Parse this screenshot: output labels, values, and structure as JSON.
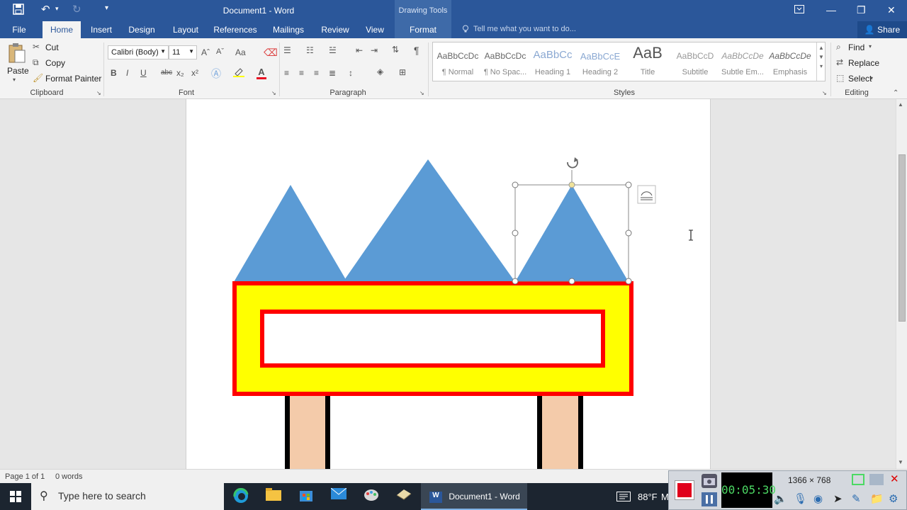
{
  "titlebar": {
    "title": "Document1 - Word",
    "contextual_group": "Drawing Tools",
    "save_icon": "save-icon",
    "undo_icon": "undo-icon",
    "redo_icon": "redo-icon",
    "customize_icon": "customize-qat-icon"
  },
  "tabs": {
    "file": "File",
    "home": "Home",
    "insert": "Insert",
    "design": "Design",
    "layout": "Layout",
    "references": "References",
    "mailings": "Mailings",
    "review": "Review",
    "view": "View",
    "format": "Format",
    "tell_me": "Tell me what you want to do...",
    "share": "Share"
  },
  "clipboard": {
    "paste": "Paste",
    "cut": "Cut",
    "copy": "Copy",
    "format_painter": "Format Painter",
    "label": "Clipboard"
  },
  "font": {
    "family": "Calibri (Body)",
    "size": "11",
    "label": "Font",
    "bold": "B",
    "italic": "I",
    "underline": "U",
    "strike": "abc",
    "subscript": "x₂",
    "superscript": "x²",
    "grow": "Aˆ",
    "shrink": "Aˇ",
    "change_case": "Aa",
    "font_color": "A",
    "font_color_hex": "#e81123",
    "highlight_hex": "#ffff00"
  },
  "paragraph": {
    "label": "Paragraph",
    "pilcrow": "¶"
  },
  "styles": {
    "label": "Styles",
    "items": [
      {
        "sample": "AaBbCcDc",
        "name": "¶ Normal"
      },
      {
        "sample": "AaBbCcDc",
        "name": "¶ No Spac..."
      },
      {
        "sample": "AaBbCc",
        "name": "Heading 1"
      },
      {
        "sample": "AaBbCcE",
        "name": "Heading 2"
      },
      {
        "sample": "AaB",
        "name": "Title"
      },
      {
        "sample": "AaBbCcD",
        "name": "Subtitle"
      },
      {
        "sample": "AaBbCcDe",
        "name": "Subtle Em..."
      },
      {
        "sample": "AaBbCcDe",
        "name": "Emphasis"
      }
    ]
  },
  "editing": {
    "label": "Editing",
    "find": "Find",
    "replace": "Replace",
    "select": "Select"
  },
  "drawing": {
    "triangle_fill": "#5b9bd5",
    "sign_fill": "#ffff00",
    "sign_border": "#ff0000",
    "post_fill": "#f4cbaa",
    "post_border": "#000000"
  },
  "status": {
    "page": "Page 1 of 1",
    "words": "0 words"
  },
  "taskbar": {
    "search_placeholder": "Type here to search",
    "word_label": "Document1 - Word",
    "temperature": "88°F",
    "temp_suffix": "M"
  },
  "recorder": {
    "timer": "00:05:30",
    "resolution": "1366 × 768"
  }
}
